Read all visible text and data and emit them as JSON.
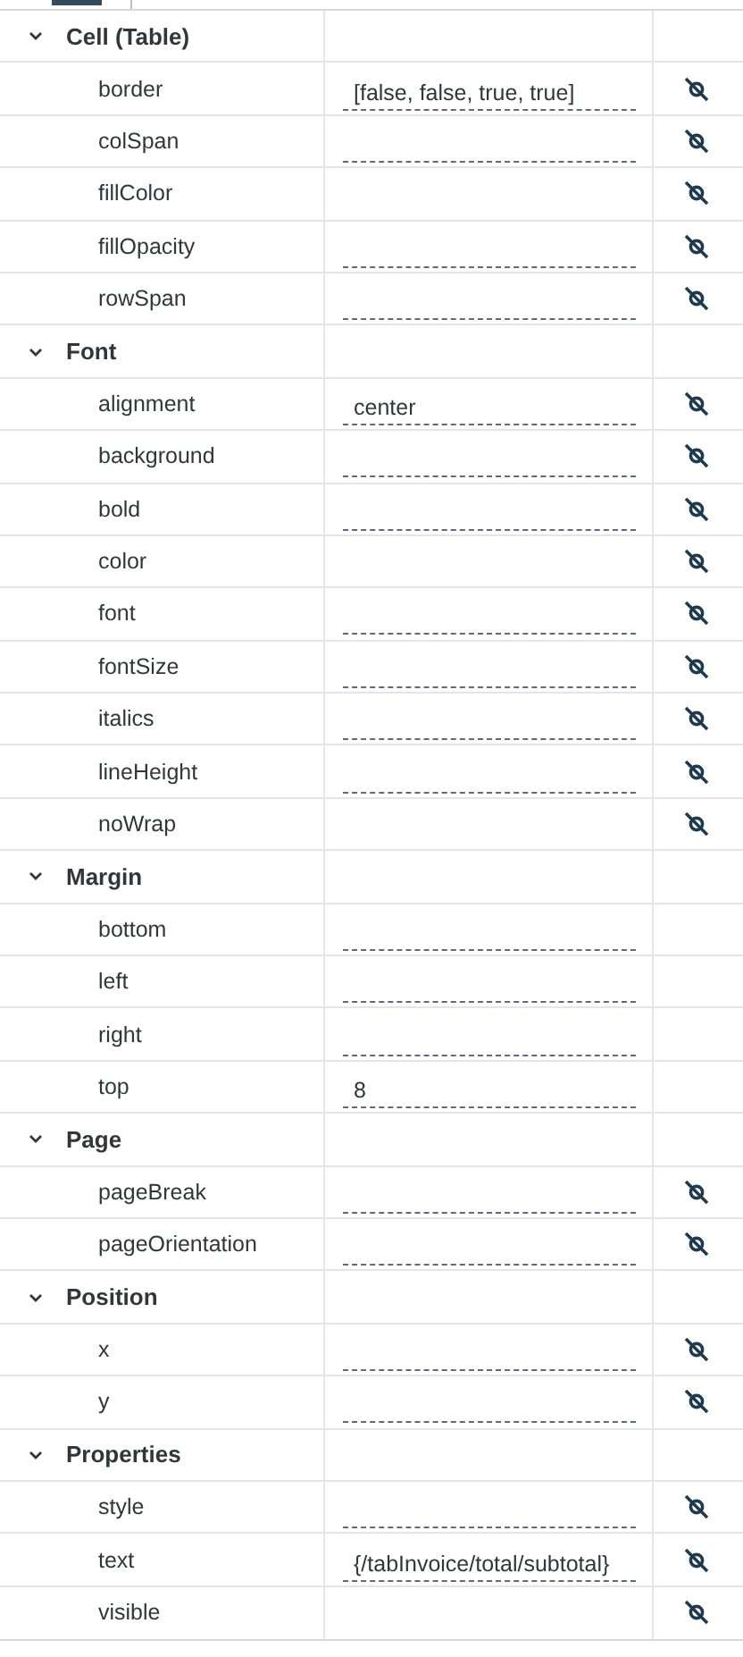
{
  "groups": [
    {
      "title": "Cell (Table)",
      "expanded": true,
      "properties": [
        {
          "name": "border",
          "value": "[false, false, true, true]",
          "field": true,
          "bound": true
        },
        {
          "name": "colSpan",
          "field": true,
          "bound": true
        },
        {
          "name": "fillColor",
          "field": false,
          "bound": true
        },
        {
          "name": "fillOpacity",
          "field": true,
          "bound": true
        },
        {
          "name": "rowSpan",
          "field": true,
          "bound": true
        }
      ]
    },
    {
      "title": "Font",
      "expanded": true,
      "properties": [
        {
          "name": "alignment",
          "value": "center",
          "field": true,
          "bound": true
        },
        {
          "name": "background",
          "field": true,
          "bound": true
        },
        {
          "name": "bold",
          "field": true,
          "bound": true
        },
        {
          "name": "color",
          "field": false,
          "bound": true
        },
        {
          "name": "font",
          "field": true,
          "bound": true
        },
        {
          "name": "fontSize",
          "field": true,
          "bound": true
        },
        {
          "name": "italics",
          "field": true,
          "bound": true
        },
        {
          "name": "lineHeight",
          "field": true,
          "bound": true
        },
        {
          "name": "noWrap",
          "field": false,
          "bound": true
        }
      ]
    },
    {
      "title": "Margin",
      "expanded": true,
      "properties": [
        {
          "name": "bottom",
          "field": true,
          "bound": false
        },
        {
          "name": "left",
          "field": true,
          "bound": false
        },
        {
          "name": "right",
          "field": true,
          "bound": false
        },
        {
          "name": "top",
          "value": "8",
          "field": true,
          "bound": false
        }
      ]
    },
    {
      "title": "Page",
      "expanded": true,
      "properties": [
        {
          "name": "pageBreak",
          "field": true,
          "bound": true
        },
        {
          "name": "pageOrientation",
          "field": true,
          "bound": true
        }
      ]
    },
    {
      "title": "Position",
      "expanded": true,
      "properties": [
        {
          "name": "x",
          "field": true,
          "bound": true
        },
        {
          "name": "y",
          "field": true,
          "bound": true
        }
      ]
    },
    {
      "title": "Properties",
      "expanded": true,
      "properties": [
        {
          "name": "style",
          "field": true,
          "bound": true
        },
        {
          "name": "text",
          "value": "{/tabInvoice/total/subtotal}",
          "field": true,
          "bound": true
        },
        {
          "name": "visible",
          "field": false,
          "bound": true
        }
      ]
    }
  ]
}
